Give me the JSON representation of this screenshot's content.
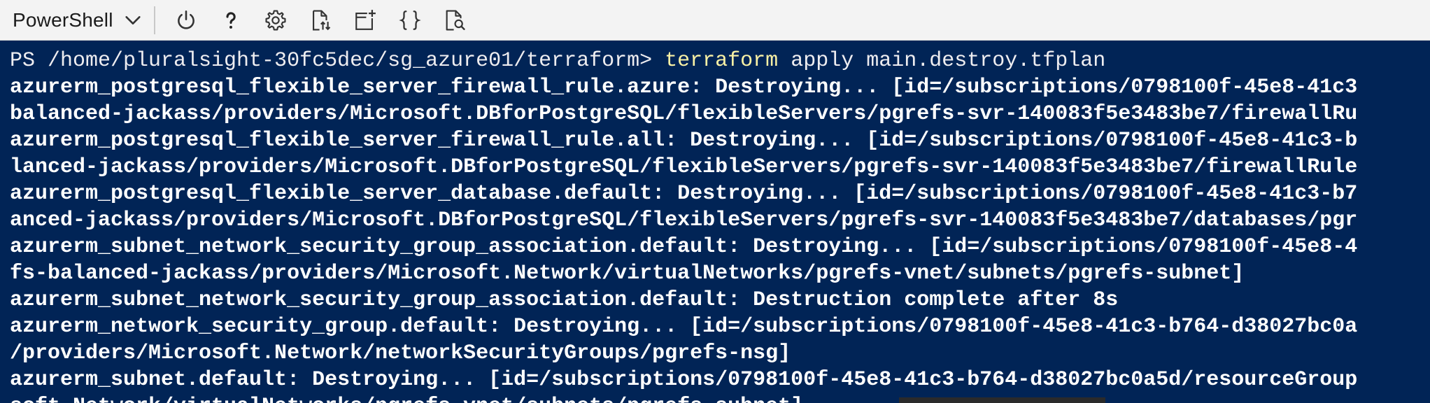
{
  "toolbar": {
    "shell_label": "PowerShell",
    "icons": [
      "chevron-down-icon",
      "power-icon",
      "help-icon",
      "gear-icon",
      "upload-download-icon",
      "new-session-icon",
      "braces-icon",
      "preview-icon"
    ]
  },
  "terminal": {
    "prompt_path": "PS /home/pluralsight-30fc5dec/sg_azure01/terraform> ",
    "prompt_cmd": "terraform",
    "prompt_args": " apply main.destroy.tfplan",
    "lines": [
      "azurerm_postgresql_flexible_server_firewall_rule.azure: Destroying... [id=/subscriptions/0798100f-45e8-41c3",
      "balanced-jackass/providers/Microsoft.DBforPostgreSQL/flexibleServers/pgrefs-svr-140083f5e3483be7/firewallRu",
      "azurerm_postgresql_flexible_server_firewall_rule.all: Destroying... [id=/subscriptions/0798100f-45e8-41c3-b",
      "lanced-jackass/providers/Microsoft.DBforPostgreSQL/flexibleServers/pgrefs-svr-140083f5e3483be7/firewallRule",
      "azurerm_postgresql_flexible_server_database.default: Destroying... [id=/subscriptions/0798100f-45e8-41c3-b7",
      "anced-jackass/providers/Microsoft.DBforPostgreSQL/flexibleServers/pgrefs-svr-140083f5e3483be7/databases/pgr",
      "azurerm_subnet_network_security_group_association.default: Destroying... [id=/subscriptions/0798100f-45e8-4",
      "fs-balanced-jackass/providers/Microsoft.Network/virtualNetworks/pgrefs-vnet/subnets/pgrefs-subnet]",
      "azurerm_subnet_network_security_group_association.default: Destruction complete after 8s",
      "azurerm_network_security_group.default: Destroying... [id=/subscriptions/0798100f-45e8-41c3-b764-d38027bc0a",
      "/providers/Microsoft.Network/networkSecurityGroups/pgrefs-nsg]",
      "azurerm_subnet.default: Destroying... [id=/subscriptions/0798100f-45e8-41c3-b764-d38027bc0a5d/resourceGroup",
      "soft.Network/virtualNetworks/pgrefs-vnet/subnets/pgrefs-subnet]"
    ]
  },
  "colors": {
    "terminal_bg": "#012456",
    "toolbar_bg": "#f3f3f3",
    "command_highlight": "#f9f1a5",
    "text": "#ffffff"
  }
}
